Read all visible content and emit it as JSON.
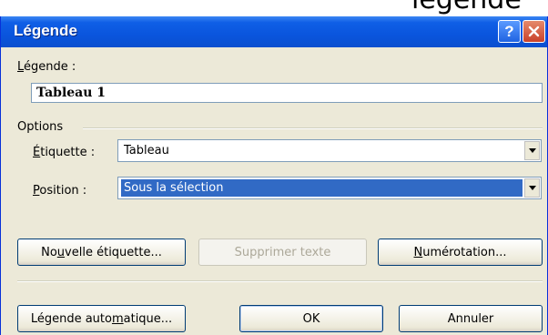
{
  "dialog": {
    "title": "Légende",
    "help_button": "?",
    "title_overflow_fragment": "légende"
  },
  "caption": {
    "label_prefix": "L",
    "label_rest": "égende :",
    "value": "Tableau 1"
  },
  "options": {
    "group_label": "Options",
    "label": {
      "label_u": "É",
      "label_rest": "tiquette :",
      "value": "Tableau"
    },
    "position": {
      "label_u": "P",
      "label_rest": "osition :",
      "value": "Sous la sélection"
    }
  },
  "buttons": {
    "new_label": {
      "before": "No",
      "u": "u",
      "after": "velle étiquette..."
    },
    "delete_label": "Supprimer texte",
    "numbering": {
      "u": "N",
      "after": "umérotation..."
    },
    "autocaption": {
      "before": "Légende auto",
      "u": "m",
      "after": "atique..."
    },
    "ok": "OK",
    "cancel": "Annuler"
  }
}
